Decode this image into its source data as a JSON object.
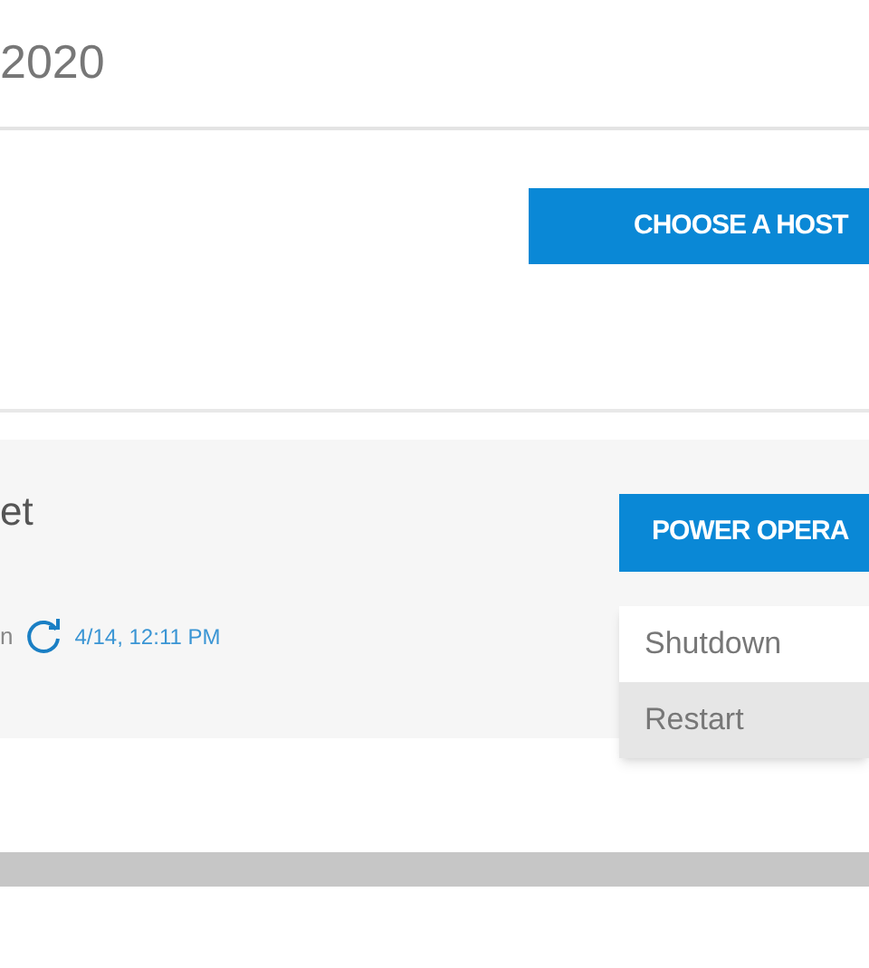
{
  "header": {
    "title": "2020"
  },
  "host_button": {
    "label": "CHOOSE A HOST"
  },
  "card": {
    "name": "et",
    "status_label": "n",
    "updated": "4/14, 12:11 PM",
    "power_button": {
      "label": "POWER OPERA"
    },
    "menu": [
      {
        "label": "Shutdown",
        "selected": false
      },
      {
        "label": "Restart",
        "selected": true
      }
    ]
  }
}
